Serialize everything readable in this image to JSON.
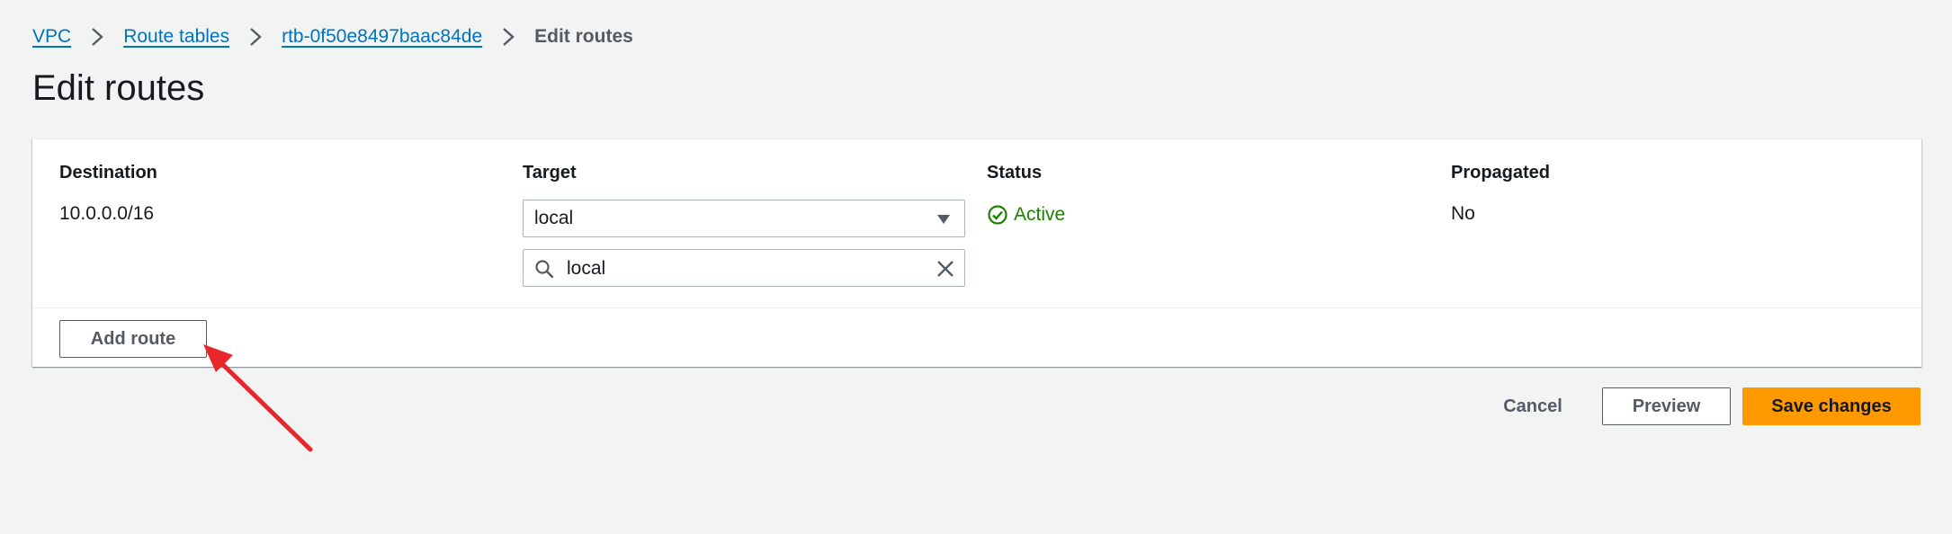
{
  "breadcrumb": {
    "items": [
      "VPC",
      "Route tables",
      "rtb-0f50e8497baac84de"
    ],
    "current": "Edit routes"
  },
  "page": {
    "title": "Edit routes"
  },
  "table": {
    "headers": {
      "destination": "Destination",
      "target": "Target",
      "status": "Status",
      "propagated": "Propagated"
    },
    "row": {
      "destination": "10.0.0.0/16",
      "target_value": "local",
      "target_filter": "local",
      "status": "Active",
      "propagated": "No"
    }
  },
  "buttons": {
    "add_route": "Add route",
    "cancel": "Cancel",
    "preview": "Preview",
    "save": "Save changes"
  },
  "colors": {
    "link": "#0073bb",
    "status_active": "#1d8102",
    "primary_button": "#ff9900",
    "annotation_arrow": "#e8262b"
  },
  "icons": [
    "chevron-right-icon",
    "caret-down-icon",
    "search-icon",
    "close-icon",
    "status-success-icon"
  ]
}
